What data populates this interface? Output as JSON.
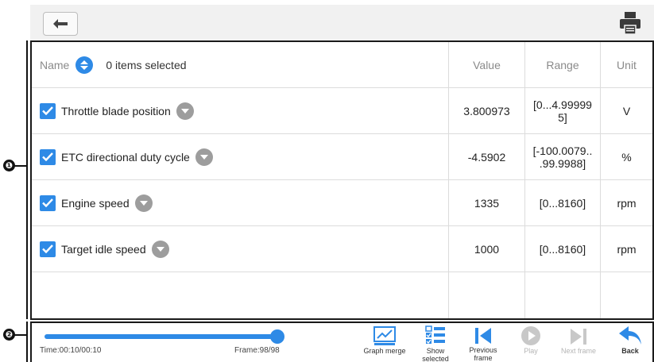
{
  "callouts": [
    "❶",
    "❷"
  ],
  "header": {
    "name_label": "Name",
    "selected_text": "0 items selected",
    "value_label": "Value",
    "range_label": "Range",
    "unit_label": "Unit"
  },
  "rows": [
    {
      "name": "Throttle blade position",
      "value": "3.800973",
      "range": "[0...4.99999\n5]",
      "unit": "V"
    },
    {
      "name": "ETC directional duty cycle",
      "value": "-4.5902",
      "range": "[-100.0079..\n.99.9988]",
      "unit": "%"
    },
    {
      "name": "Engine speed",
      "value": "1335",
      "range": "[0...8160]",
      "unit": "rpm"
    },
    {
      "name": "Target idle speed",
      "value": "1000",
      "range": "[0...8160]",
      "unit": "rpm"
    }
  ],
  "playback": {
    "time": "Time:00:10/00:10",
    "frame": "Frame:98/98",
    "progress": 1.0
  },
  "toolbar": {
    "graph_merge": "Graph merge",
    "show_selected": "Show selected",
    "previous_frame": "Previous frame",
    "play": "Play",
    "next_frame": "Next frame",
    "back": "Back"
  },
  "colors": {
    "accent": "#2e8ae6",
    "disabled": "#c8c8c8"
  }
}
